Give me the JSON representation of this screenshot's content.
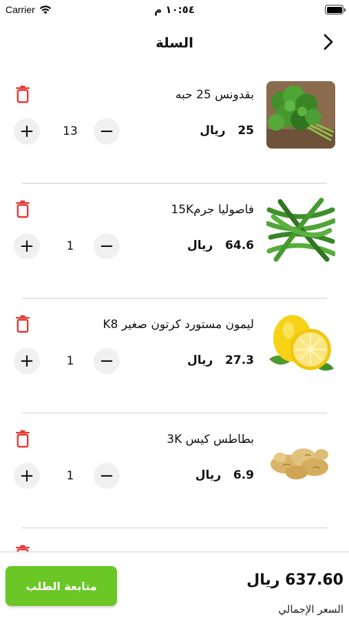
{
  "status_bar": {
    "carrier": "Carrier",
    "time": "١٠:٥٤ م"
  },
  "nav": {
    "title": "السلة"
  },
  "currency": "ريال",
  "items": [
    {
      "name": "بقدونس 25 حبه",
      "price": "25",
      "quantity": "13",
      "image": "parsley"
    },
    {
      "name": "فاصوليا جرم15K",
      "price": "64.6",
      "quantity": "1",
      "image": "green-beans"
    },
    {
      "name": "ليمون مستورد كرتون صغير K8",
      "price": "27.3",
      "quantity": "1",
      "image": "lemon"
    },
    {
      "name": "بطاطس كيس 3K",
      "price": "6.9",
      "quantity": "1",
      "image": "ginger"
    },
    {
      "name": "",
      "price": "",
      "quantity": "",
      "image": "partial"
    }
  ],
  "footer": {
    "total": "637.60 ريال",
    "total_label": "السعر الإجمالي",
    "checkout_label": "متابعة الطلب"
  },
  "colors": {
    "accent": "#6ac725",
    "delete": "#e53935"
  }
}
